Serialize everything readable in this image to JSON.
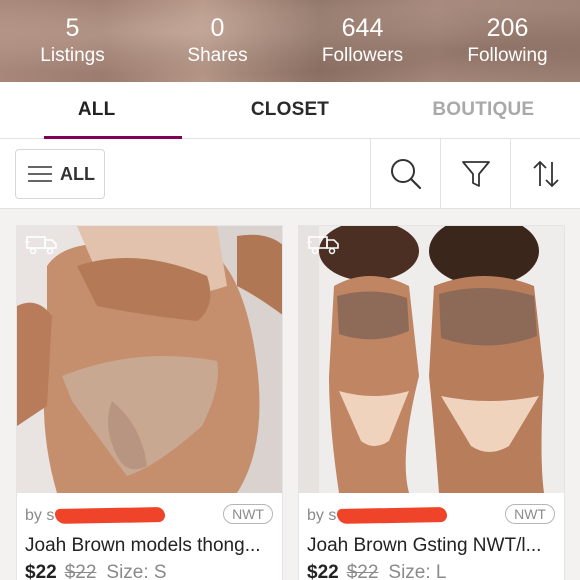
{
  "stats": [
    {
      "value": "5",
      "label": "Listings"
    },
    {
      "value": "0",
      "label": "Shares"
    },
    {
      "value": "644",
      "label": "Followers"
    },
    {
      "value": "206",
      "label": "Following"
    }
  ],
  "tabs": [
    {
      "label": "ALL",
      "active": true
    },
    {
      "label": "CLOSET",
      "active": false
    },
    {
      "label": "BOUTIQUE",
      "active": false
    }
  ],
  "filter": {
    "all_label": "ALL",
    "icons": [
      "search-icon",
      "filter-funnel-icon",
      "sort-arrows-icon"
    ]
  },
  "accent_color": "#7f0353",
  "listings": [
    {
      "by_prefix": "by s",
      "badge": "NWT",
      "title": "Joah Brown models thong...",
      "price": "$22",
      "original_price": "$22",
      "size": "Size: S",
      "shipping_icon": "truck-icon"
    },
    {
      "by_prefix": "by s",
      "badge": "NWT",
      "title": "Joah Brown Gsting NWT/l...",
      "price": "$22",
      "original_price": "$22",
      "size": "Size: L",
      "shipping_icon": "truck-icon"
    }
  ]
}
